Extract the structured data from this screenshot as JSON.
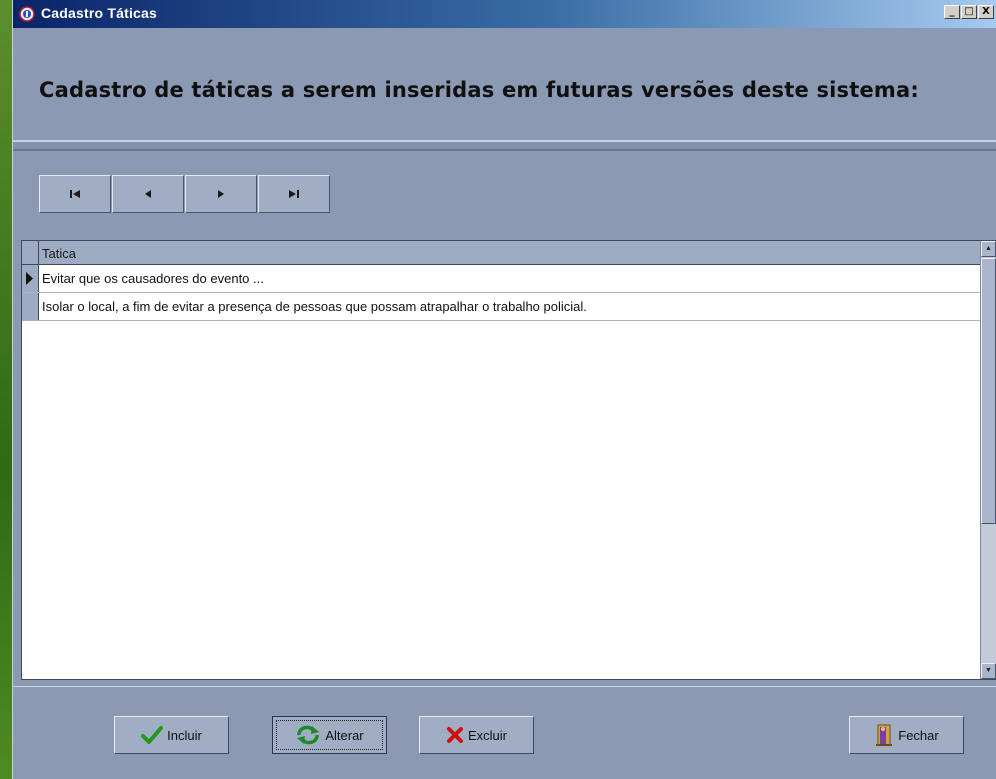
{
  "window": {
    "title": "Cadastro Táticas",
    "controls": {
      "minimize": "_",
      "maximize": "□",
      "close": "X"
    }
  },
  "heading": "Cadastro de táticas a serem inseridas em futuras versões deste sistema:",
  "navigator": {
    "buttons": [
      {
        "name": "first-record",
        "icon": "first-icon"
      },
      {
        "name": "prior-record",
        "icon": "prior-icon"
      },
      {
        "name": "next-record",
        "icon": "next-icon"
      },
      {
        "name": "last-record",
        "icon": "last-icon"
      }
    ]
  },
  "grid": {
    "columns": [
      "Tatica"
    ],
    "rows": [
      {
        "tatica": "Evitar que os causadores do evento ...",
        "current": true
      },
      {
        "tatica": "Isolar o local, a fim de evitar a presença de pessoas que possam atrapalhar o trabalho policial.",
        "current": false
      }
    ]
  },
  "actions": {
    "incluir": "Incluir",
    "alterar": "Alterar",
    "excluir": "Excluir",
    "fechar": "Fechar"
  },
  "colors": {
    "window_bg": "#8b99b2",
    "titlebar_start": "#0a246a",
    "titlebar_end": "#a6caf0",
    "check_green": "#1f9a1f",
    "delete_red": "#d01010"
  }
}
